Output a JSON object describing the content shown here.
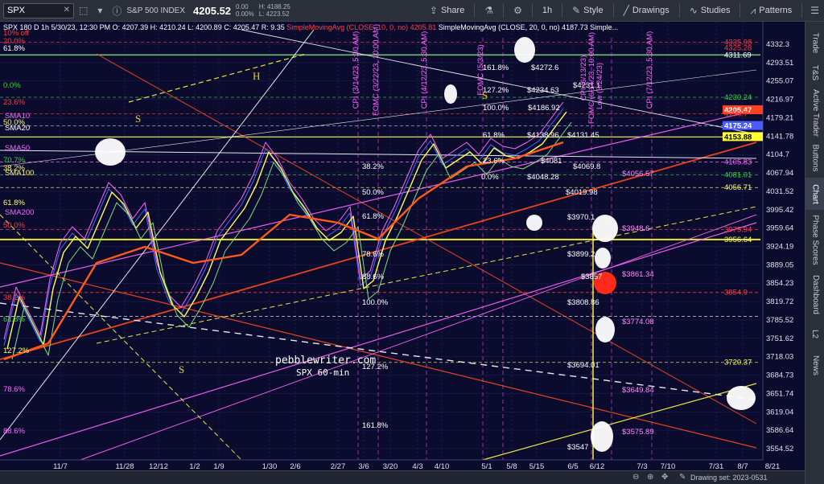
{
  "toolbar": {
    "symbol": "SPX",
    "symbol_clear": "✕",
    "description": "S&P 500 INDEX",
    "last_price": "4205.52",
    "net_change": "0.00",
    "pct_change": "0.00%",
    "hi_label": "H: 4188.25",
    "lo_label": "L: 4223.52",
    "share": "Share",
    "timeframe": "1h",
    "style": "Style",
    "drawings": "Drawings",
    "studies": "Studies",
    "patterns": "Patterns"
  },
  "legend": {
    "line1": "SPX 180 D 1h  5/30/23, 12:30 PM  O: 4207.39  H: 4210.24  L: 4200.89  C: 4205.47  R: 9.35",
    "sma10": "SimpleMovingAvg (CLOSE, 10, 0, no)  4205.81",
    "sma20": "SimpleMovingAvg (CLOSE, 20, 0, no)  4187.73  Simple..."
  },
  "watermark": {
    "site": "pebblewriter.com",
    "caption": "SPX 60-min"
  },
  "price_axis": [
    "4332.3",
    "4293.51",
    "4255.07",
    "4216.97",
    "4179.21",
    "4141.78",
    "4104.7",
    "4067.94",
    "4031.52",
    "3995.42",
    "3959.64",
    "3924.19",
    "3889.05",
    "3854.23",
    "3819.72",
    "3785.52",
    "3751.62",
    "3718.03",
    "3684.73",
    "3651.74",
    "3619.04",
    "3586.64",
    "3554.52"
  ],
  "price_tags": [
    {
      "v": "4335.98",
      "c": "#ff3b3b"
    },
    {
      "v": "4325.28",
      "c": "#ff3b3b"
    },
    {
      "v": "4311.69",
      "c": "#ffffff"
    },
    {
      "v": "4230.24",
      "c": "#38d638"
    },
    {
      "v": "4205.47",
      "c": "#ffffff",
      "bg": "#ff4020"
    },
    {
      "v": "4198.7",
      "c": "#ff3b3b"
    },
    {
      "v": "4175.24",
      "c": "#ffffff",
      "bg": "#4a5cff"
    },
    {
      "v": "4153.88",
      "c": "#000000",
      "bg": "#ffff33"
    },
    {
      "v": "4105.83",
      "c": "#ff66ff"
    },
    {
      "v": "4081.01",
      "c": "#38d638"
    },
    {
      "v": "4056.71",
      "c": "#ffff66"
    },
    {
      "v": "3975.94",
      "c": "#ff3b3b"
    },
    {
      "v": "3956.64",
      "c": "#ffff66"
    },
    {
      "v": "3854.9",
      "c": "#ff3b3b"
    },
    {
      "v": "3720.37",
      "c": "#ffff66"
    }
  ],
  "time_axis": [
    "11/7",
    "11/28",
    "12/12",
    "1/2",
    "1/9",
    "1/30",
    "2/6",
    "2/27",
    "3/6",
    "3/20",
    "4/3",
    "4/10",
    "5/1",
    "5/8",
    "5/15",
    "6/5",
    "6/12",
    "7/3",
    "7/10",
    "7/31",
    "8/7",
    "8/21"
  ],
  "fib_labels": [
    {
      "t": "161.8%"
    },
    {
      "t": "127.2%"
    },
    {
      "t": "100.0%"
    },
    {
      "t": "61.8%"
    },
    {
      "t": "23.6%"
    },
    {
      "t": "0.0%"
    },
    {
      "t": "38.2%"
    },
    {
      "t": "50.0%"
    },
    {
      "t": "61.8%"
    },
    {
      "t": "78.6%"
    },
    {
      "t": "88.6%"
    },
    {
      "t": "100.0%"
    },
    {
      "t": "127.2%"
    },
    {
      "t": "161.8%"
    }
  ],
  "level_labels": [
    "$4272.6",
    "$4234.63",
    "$4231.1",
    "$4186.92",
    "$4138.96",
    "$4131.45",
    "$4081",
    "$4069.8",
    "$4048.28",
    "$4056.57",
    "$4019.98",
    "$3970.1",
    "$3948.6",
    "$3899.2",
    "$3861.34",
    "$3857",
    "$3808.86",
    "$3774.08",
    "$3694.01",
    "$3649.84",
    "$3575.89",
    "$3547"
  ],
  "ma_labels": [
    "SMA10",
    "SMA20",
    "SMA50",
    "SMA100",
    "SMA200"
  ],
  "left_fib": [
    "10% off",
    "20.0%",
    "61.8%",
    "0.0%",
    "23.6%",
    "50.0%",
    "70.7%",
    "38.2%",
    "61.8%",
    "50.0%",
    "38.2%",
    "61.8%",
    "127.2%",
    "78.6%",
    "88.6%"
  ],
  "hs_letters": [
    "H",
    "S",
    "S",
    "S"
  ],
  "vline_labels": [
    "CPI (3/14/23, 5:30 AM)",
    "FOMC (3/22/23, 10:00 AM)",
    "CPI (4/12/23, 5:30 AM)",
    "FOMC (5/3/23)",
    "CPI (6/13/23)",
    "FOMC (6/14/23, 10:00 AM)",
    "CPI (7/12/23, 5:30 AM)",
    "Low (5/24/23)"
  ],
  "rightbar": [
    "Trade",
    "T&S",
    "Active Trader",
    "Buttons",
    "Chart",
    "Phase Scores",
    "Dashboard",
    "L2",
    "News"
  ],
  "bottombar": {
    "drawing_set": "Drawing set: 2023-0531"
  }
}
